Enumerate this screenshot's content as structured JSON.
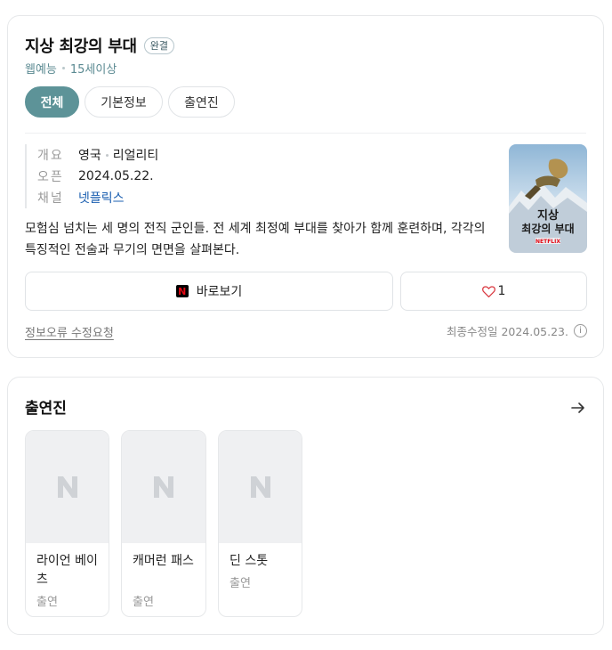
{
  "title": "지상 최강의 부대",
  "status_badge": "완결",
  "meta": {
    "type": "웹예능",
    "rating": "15세이상"
  },
  "tabs": [
    {
      "label": "전체",
      "active": true
    },
    {
      "label": "기본정보",
      "active": false
    },
    {
      "label": "출연진",
      "active": false
    }
  ],
  "info": {
    "overview_key": "개요",
    "country": "영국",
    "genre": "리얼리티",
    "open_key": "오픈",
    "open_date": "2024.05.22.",
    "channel_key": "채널",
    "channel": "넷플릭스"
  },
  "poster": {
    "title_line1": "지상",
    "title_line2": "최강의 부대",
    "brand": "NETFLIX"
  },
  "description": "모험심 넘치는 세 명의 전직 군인들. 전 세계 최정예 부대를 찾아가 함께 훈련하며, 각각의 특징적인 전술과 무기의 면면을 살펴본다.",
  "actions": {
    "watch_label": "바로보기",
    "like_count": "1"
  },
  "footer": {
    "report_label": "정보오류 수정요청",
    "updated_label": "최종수정일 2024.05.23."
  },
  "cast": {
    "section_title": "출연진",
    "members": [
      {
        "name": "라이언 베이츠",
        "role": "출연"
      },
      {
        "name": "캐머런 패스",
        "role": "출연"
      },
      {
        "name": "딘 스톳",
        "role": "출연"
      }
    ]
  },
  "colors": {
    "accent": "#5d9398",
    "link": "#1b5fb0",
    "netflix_red": "#e50914"
  }
}
